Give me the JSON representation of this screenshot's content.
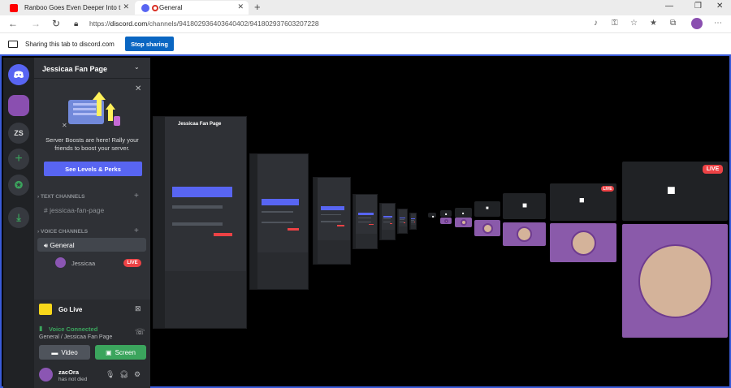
{
  "browser": {
    "tabs": [
      {
        "title": "Ranboo Goes Even Deeper Into t",
        "icon": "youtube-icon",
        "active": false
      },
      {
        "title": "General",
        "icon": "discord-icon",
        "active": true
      }
    ],
    "url_prefix": "https://",
    "url_host": "discord.com",
    "url_path": "/channels/941802936403640402/941802937603207228",
    "share_text": "Sharing this tab to discord.com",
    "stop_sharing": "Stop sharing",
    "colors": {
      "accent": "#0a66c2",
      "share_border": "#3a5bd9"
    }
  },
  "discord": {
    "server_name": "Jessicaa Fan Page",
    "rail": {
      "zs_label": "ZS"
    },
    "boost": {
      "text": "Server Boosts are here! Rally your friends to boost your server.",
      "button": "See Levels & Perks"
    },
    "text_category": "TEXT CHANNELS",
    "text_channel": "jessicaa-fan-page",
    "voice_category": "VOICE CHANNELS",
    "voice_channel": "General",
    "voice_user": "Jessicaa",
    "live_badge": "LIVE",
    "go_live": "Go Live",
    "voice_connected": "Voice Connected",
    "voice_sub": "General / Jessicaa Fan Page",
    "video_button": "Video",
    "screen_button": "Screen",
    "user": {
      "name": "zacOra",
      "status": "has not died"
    },
    "colors": {
      "blurple": "#5865f2",
      "green": "#3ba55d",
      "red": "#ed4245",
      "panel": "#2f3136",
      "rail": "#202225"
    }
  },
  "mini_server_name": "Jessicaa Fan Page"
}
